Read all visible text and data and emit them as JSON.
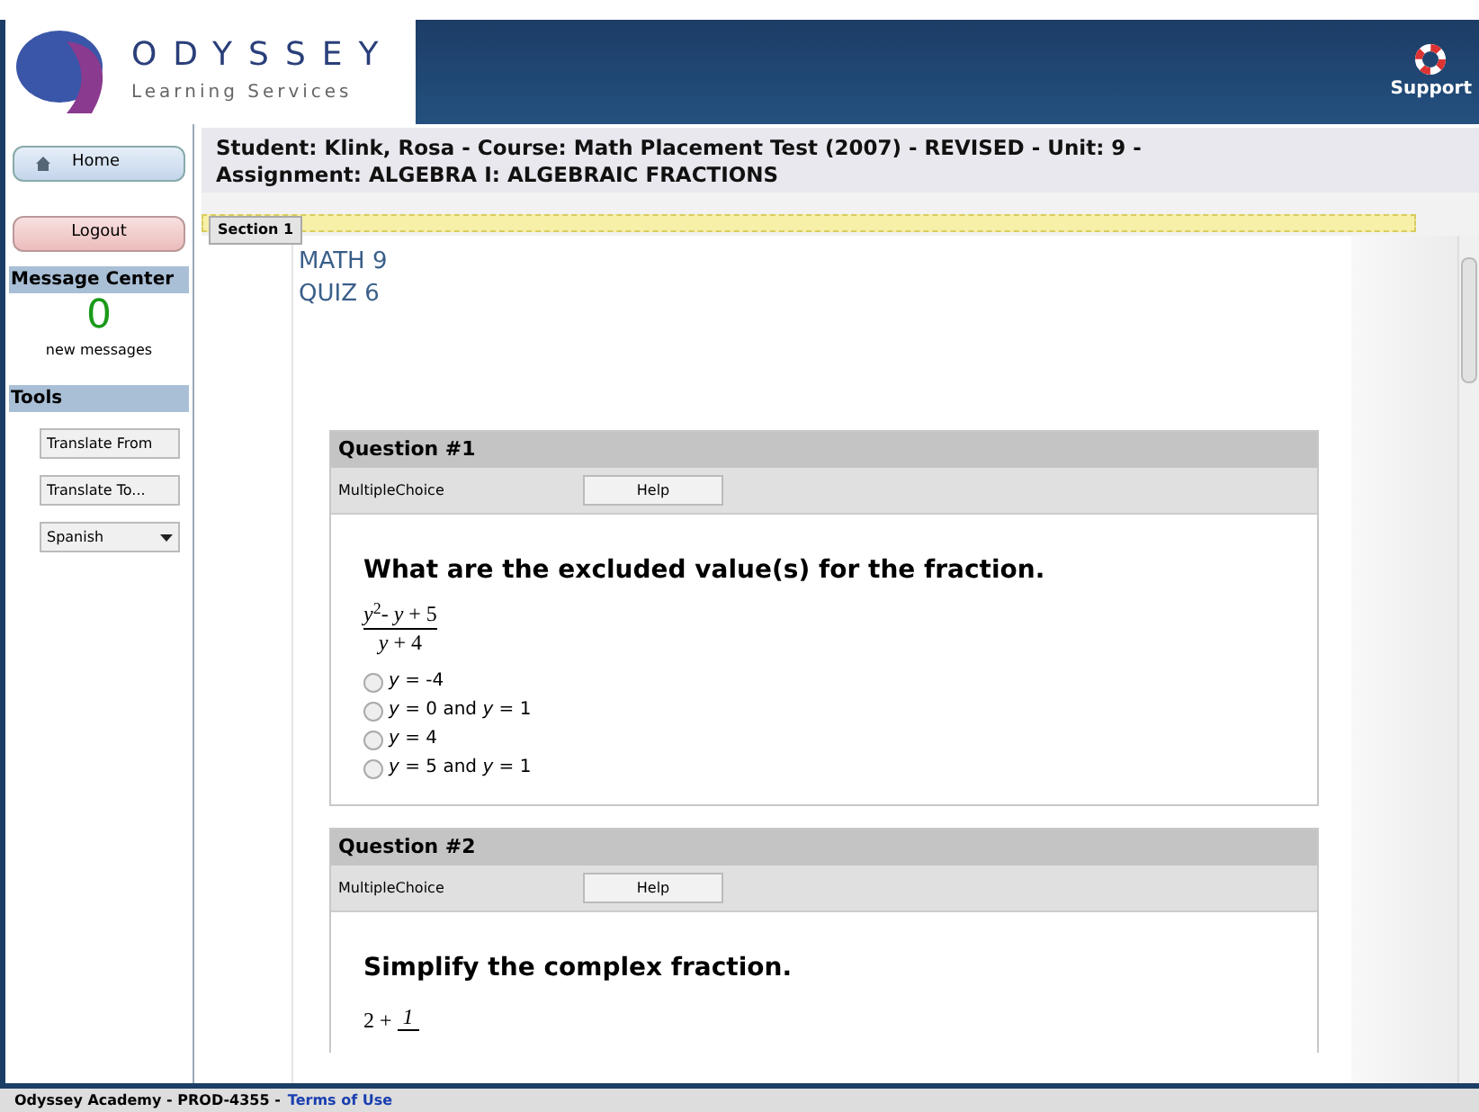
{
  "header": {
    "logo_title": "ODYSSEY",
    "logo_subtitle": "Learning Services",
    "support": "Support"
  },
  "sidebar": {
    "home": "Home",
    "logout": "Logout",
    "message_center": {
      "title": "Message Center",
      "count": "0",
      "label": "new messages"
    },
    "tools": {
      "title": "Tools",
      "buttons": [
        "Translate From",
        "Translate To..."
      ],
      "language": "Spanish"
    }
  },
  "info": {
    "line1": "Student: Klink, Rosa  - Course: Math Placement Test (2007) - REVISED  - Unit: 9  -",
    "line2": "Assignment: ALGEBRA I: ALGEBRAIC FRACTIONS"
  },
  "tabs": [
    {
      "label": "Section 1",
      "selected": true
    }
  ],
  "quiz": {
    "title": "MATH 9",
    "subtitle": "QUIZ 6"
  },
  "questions": [
    {
      "title": "Question #1",
      "type": "MultipleChoice",
      "help": "Help",
      "prompt": "What are the excluded value(s) for the fraction.",
      "numerator": "*y*$^{2}$- *y* + 5",
      "denominator": "*y* + 4",
      "options": [
        {
          "label": "*y* = -4",
          "selected": false
        },
        {
          "label": "*y* = 0 and *y* = 1",
          "selected": false
        },
        {
          "label": "*y* = 4",
          "selected": false
        },
        {
          "label": "*y* = 5 and *y* = 1",
          "selected": false
        }
      ]
    },
    {
      "title": "Question #2",
      "type": "MultipleChoice",
      "help": "Help",
      "prompt": "Simplify the complex fraction.",
      "lead": "2 +",
      "numerator": "1"
    }
  ],
  "footer": {
    "text": "Odyssey Academy - PROD-4355 -",
    "link": "Terms of Use"
  }
}
